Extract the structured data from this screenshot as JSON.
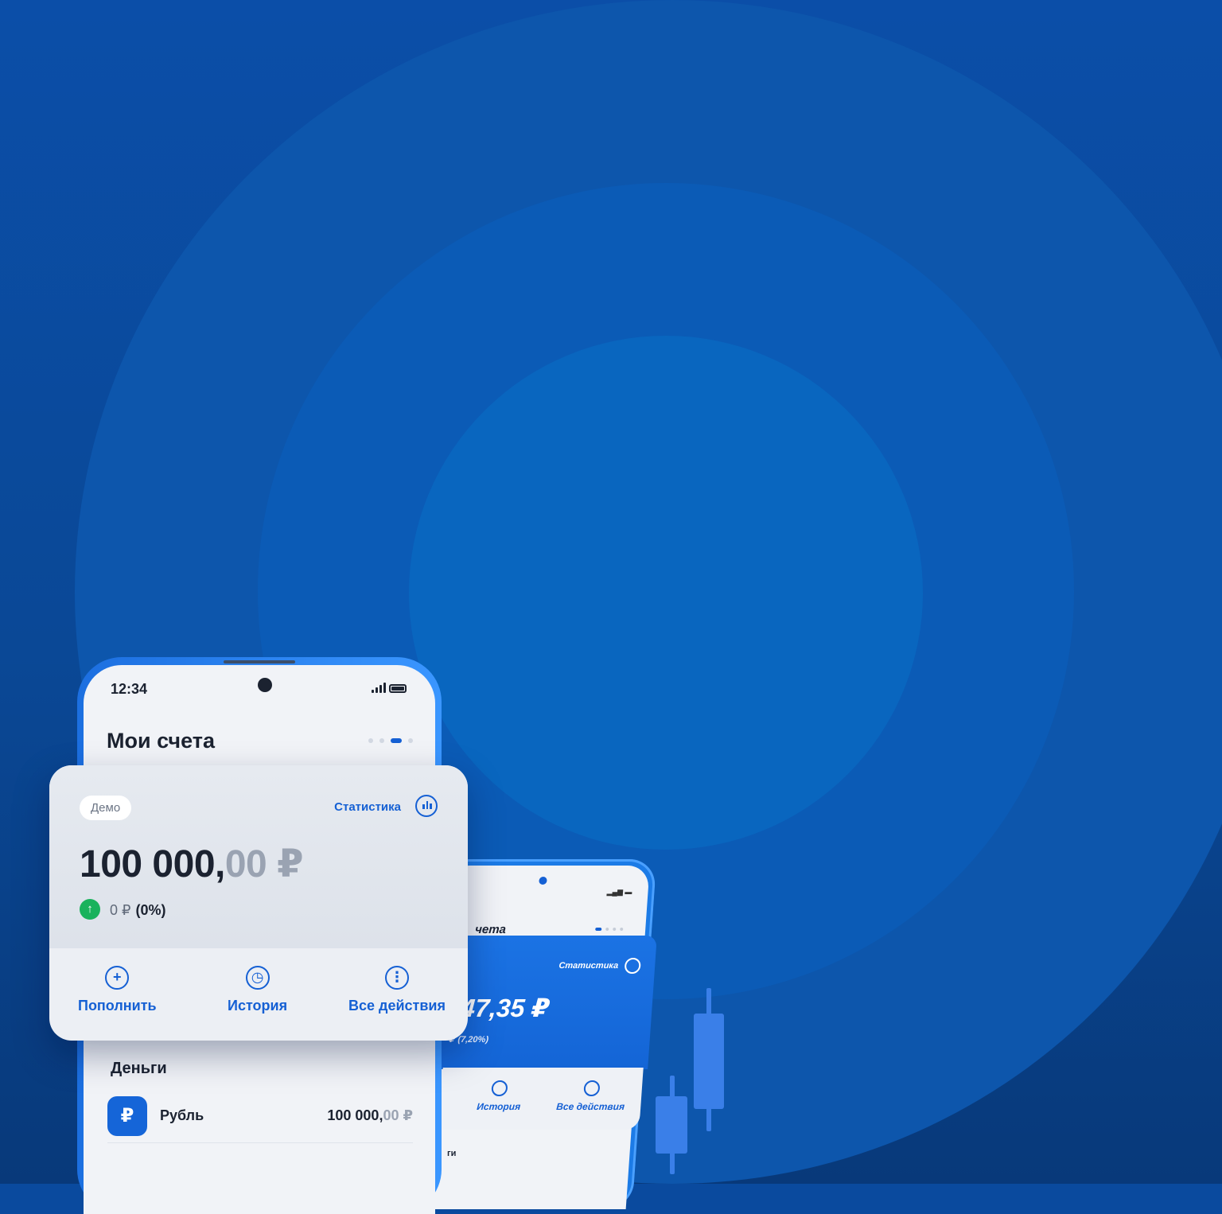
{
  "front_phone": {
    "status_time": "12:34",
    "title": "Мои счета",
    "card": {
      "badge": "Демо",
      "stat_label": "Статистика",
      "amount_main": "100 000,",
      "amount_fraction": "00 ₽",
      "change_value": "0 ₽",
      "change_percent": "(0%)",
      "actions": [
        {
          "label": "Пополнить",
          "icon": "plus-circle-icon"
        },
        {
          "label": "История",
          "icon": "clock-icon"
        },
        {
          "label": "Все действия",
          "icon": "more-vertical-icon"
        }
      ]
    },
    "money_section": {
      "title": "Деньги",
      "currency_icon": "₽",
      "currency_name": "Рубль",
      "value_main": "100 000,",
      "value_fraction": "00 ₽"
    }
  },
  "back_phone": {
    "title": "чета",
    "stat_label": "Статистика",
    "amount": "47,35 ₽",
    "change": "₽ (7,20%)",
    "actions": [
      "История",
      "Все действия"
    ],
    "money_label": "ги"
  },
  "colors": {
    "background": "#0a4a9e",
    "accent": "#1560d4",
    "positive": "#19b25c"
  }
}
